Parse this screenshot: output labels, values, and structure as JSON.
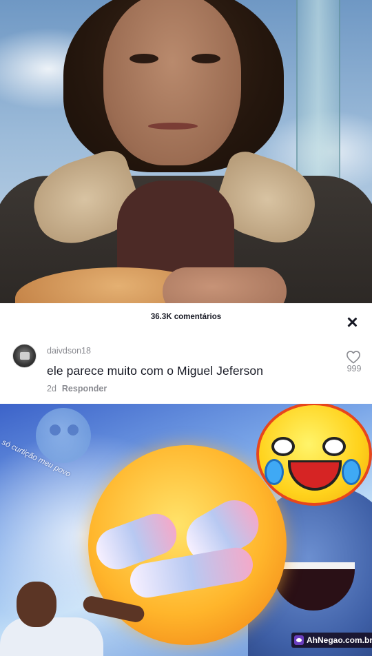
{
  "comments_sheet": {
    "title": "36.3K comentários",
    "close_icon": "close-icon",
    "comment": {
      "avatar_icon": "user-avatar",
      "username": "daivdson18",
      "text": "ele parece muito com o Miguel Jeferson",
      "age": "2d",
      "reply_label": "Responder",
      "like_icon": "heart-outline-icon",
      "like_count": "999"
    }
  },
  "meme": {
    "caption": "só curtição meu povo"
  },
  "watermark": {
    "text": "AhNegao.com.br",
    "logo_icon": "ahnegao-logo-icon"
  }
}
